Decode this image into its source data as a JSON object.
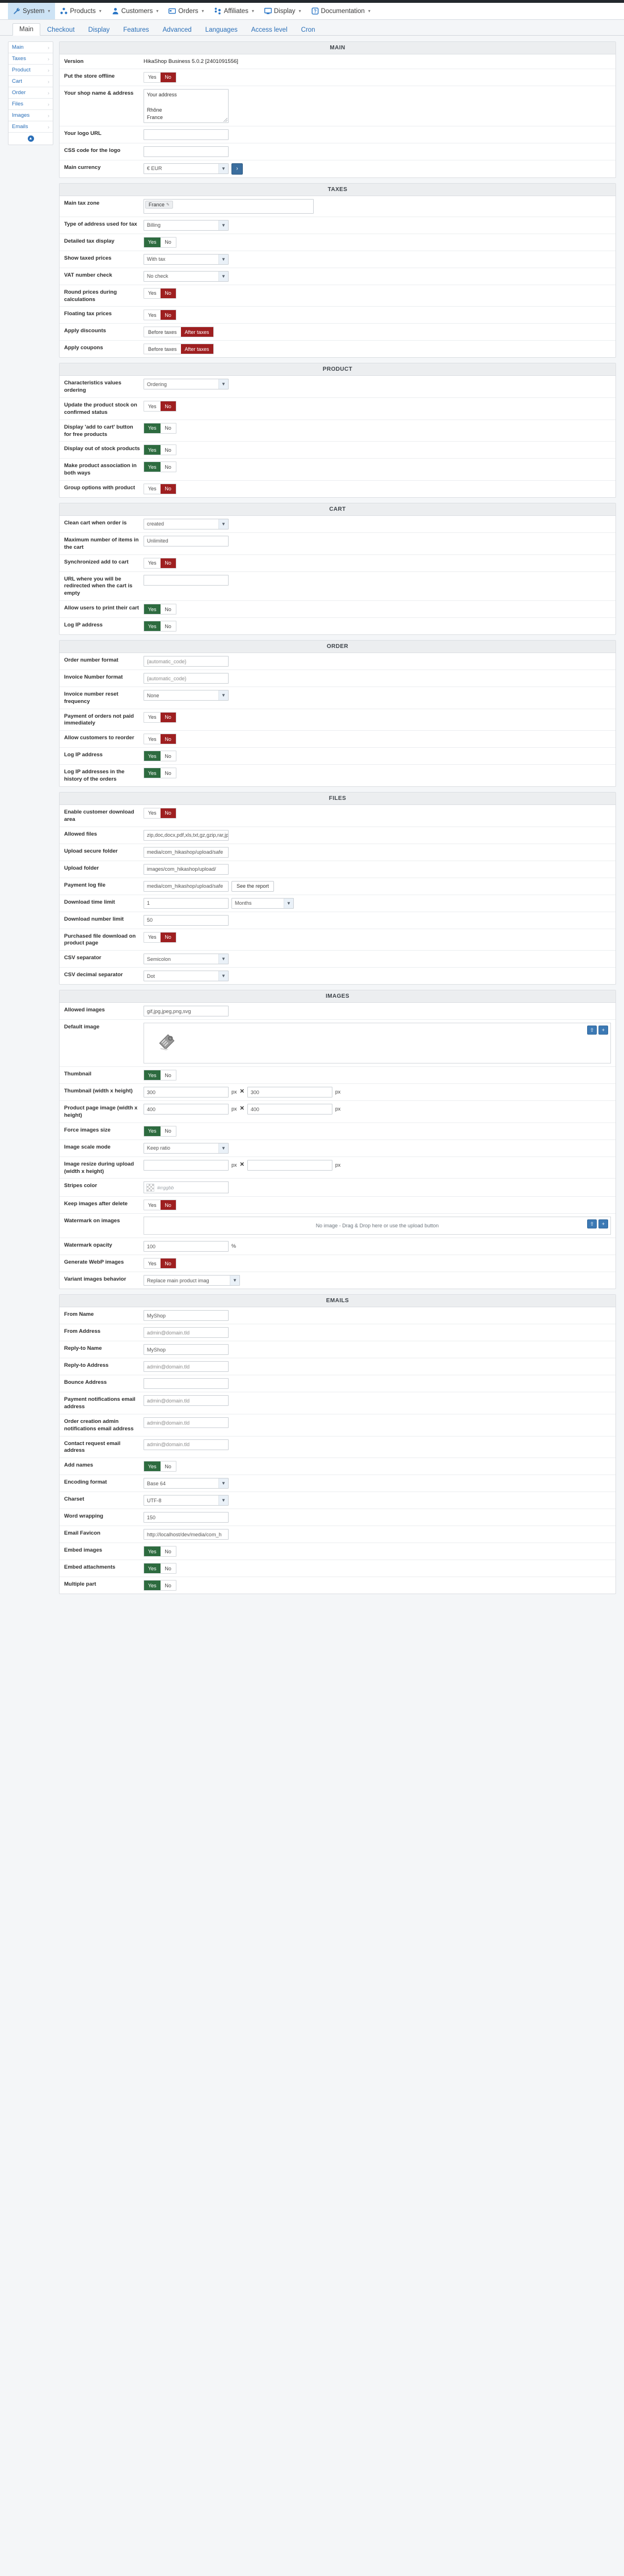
{
  "adminbar": {
    "items": [
      {
        "label": "System",
        "icon": "wrench-icon",
        "active": true
      },
      {
        "label": "Products",
        "icon": "products-icon",
        "active": false
      },
      {
        "label": "Customers",
        "icon": "user-icon",
        "active": false
      },
      {
        "label": "Orders",
        "icon": "orders-icon",
        "active": false
      },
      {
        "label": "Affiliates",
        "icon": "affiliates-icon",
        "active": false
      },
      {
        "label": "Display",
        "icon": "monitor-icon",
        "active": false
      },
      {
        "label": "Documentation",
        "icon": "book-icon",
        "active": false
      }
    ]
  },
  "tabs": [
    {
      "label": "Main",
      "active": true
    },
    {
      "label": "Checkout",
      "active": false
    },
    {
      "label": "Display",
      "active": false
    },
    {
      "label": "Features",
      "active": false
    },
    {
      "label": "Advanced",
      "active": false
    },
    {
      "label": "Languages",
      "active": false
    },
    {
      "label": "Access level",
      "active": false
    },
    {
      "label": "Cron",
      "active": false
    }
  ],
  "sidebar": {
    "items": [
      {
        "label": "Main"
      },
      {
        "label": "Taxes"
      },
      {
        "label": "Product"
      },
      {
        "label": "Cart"
      },
      {
        "label": "Order"
      },
      {
        "label": "Files"
      },
      {
        "label": "Images"
      },
      {
        "label": "Emails"
      }
    ]
  },
  "sections": {
    "main": {
      "title": "MAIN",
      "version_label": "Version",
      "version_value": "HikaShop Business 5.0.2 [2401091556]",
      "offline_label": "Put the store offline",
      "offline_yes": "Yes",
      "offline_no": "No",
      "offline_state": "no",
      "address_label": "Your shop name & address",
      "address_value": "Your address\n\nRhône\nFrance",
      "logo_url_label": "Your logo URL",
      "logo_url_value": "",
      "logo_css_label": "CSS code for the logo",
      "logo_css_value": "",
      "currency_label": "Main currency",
      "currency_value": "€ EUR",
      "currency_go": "›"
    },
    "taxes": {
      "title": "TAXES",
      "zone_label": "Main tax zone",
      "zone_chip": "France",
      "addr_type_label": "Type of address used for tax",
      "addr_type_value": "Billing",
      "detailed_label": "Detailed tax display",
      "detailed_yes": "Yes",
      "detailed_no": "No",
      "detailed_state": "yes",
      "show_taxed_label": "Show taxed prices",
      "show_taxed_value": "With tax",
      "vat_label": "VAT number check",
      "vat_value": "No check",
      "round_label": "Round prices during calculations",
      "round_yes": "Yes",
      "round_no": "No",
      "round_state": "no",
      "float_label": "Floating tax prices",
      "float_yes": "Yes",
      "float_no": "No",
      "float_state": "no",
      "discounts_label": "Apply discounts",
      "discounts_before": "Before taxes",
      "discounts_after": "After taxes",
      "discounts_state": "after",
      "coupons_label": "Apply coupons",
      "coupons_before": "Before taxes",
      "coupons_after": "After taxes",
      "coupons_state": "after"
    },
    "product": {
      "title": "PRODUCT",
      "charord_label": "Characteristics values ordering",
      "charord_value": "Ordering",
      "stock_label": "Update the product stock on confirmed status",
      "stock_yes": "Yes",
      "stock_no": "No",
      "stock_state": "no",
      "freecart_label": "Display 'add to cart' button for free products",
      "freecart_yes": "Yes",
      "freecart_no": "No",
      "freecart_state": "yes",
      "outofstock_label": "Display out of stock products",
      "outofstock_yes": "Yes",
      "outofstock_no": "No",
      "outofstock_state": "yes",
      "assoc_label": "Make product association in both ways",
      "assoc_yes": "Yes",
      "assoc_no": "No",
      "assoc_state": "yes",
      "groupopt_label": "Group options with product",
      "groupopt_yes": "Yes",
      "groupopt_no": "No",
      "groupopt_state": "no"
    },
    "cart": {
      "title": "CART",
      "clean_label": "Clean cart when order is",
      "clean_value": "created",
      "maxitems_label": "Maximum number of items in the cart",
      "maxitems_value": "Unlimited",
      "sync_label": "Synchronized add to cart",
      "sync_yes": "Yes",
      "sync_no": "No",
      "sync_state": "no",
      "redirect_label": "URL where you will be redirected when the cart is empty",
      "redirect_value": "",
      "printcart_label": "Allow users to print their cart",
      "printcart_yes": "Yes",
      "printcart_no": "No",
      "printcart_state": "yes",
      "logip_label": "Log IP address",
      "logip_yes": "Yes",
      "logip_no": "No",
      "logip_state": "yes"
    },
    "order": {
      "title": "ORDER",
      "ordernum_label": "Order number format",
      "ordernum_value": "{automatic_code}",
      "invnum_label": "Invoice Number format",
      "invnum_value": "{automatic_code}",
      "invreset_label": "Invoice number reset frequency",
      "invreset_value": "None",
      "paynotpaid_label": "Payment of orders not paid immediately",
      "paynotpaid_yes": "Yes",
      "paynotpaid_no": "No",
      "paynotpaid_state": "no",
      "reorder_label": "Allow customers to reorder",
      "reorder_yes": "Yes",
      "reorder_no": "No",
      "reorder_state": "no",
      "logip_label": "Log IP address",
      "logip_yes": "Yes",
      "logip_no": "No",
      "logip_state": "yes",
      "loghist_label": "Log IP addresses in the history of the orders",
      "loghist_yes": "Yes",
      "loghist_no": "No",
      "loghist_state": "yes"
    },
    "files": {
      "title": "FILES",
      "dlarea_label": "Enable customer download area",
      "dlarea_yes": "Yes",
      "dlarea_no": "No",
      "dlarea_state": "no",
      "allowed_label": "Allowed files",
      "allowed_value": "zip,doc,docx,pdf,xls,txt,gz,gzip,rar,jpg",
      "securefolder_label": "Upload secure folder",
      "securefolder_value": "media/com_hikashop/upload/safe",
      "uploadfolder_label": "Upload folder",
      "uploadfolder_value": "images/com_hikashop/upload/",
      "paylog_label": "Payment log file",
      "paylog_value": "media/com_hikashop/upload/safe",
      "paylog_button": "See the report",
      "dltime_label": "Download time limit",
      "dltime_value": "1",
      "dltime_unit": "Months",
      "dlnum_label": "Download number limit",
      "dlnum_value": "50",
      "purchased_label": "Purchased file download on product page",
      "purchased_yes": "Yes",
      "purchased_no": "No",
      "purchased_state": "no",
      "csvsep_label": "CSV separator",
      "csvsep_value": "Semicolon",
      "csvdec_label": "CSV decimal separator",
      "csvdec_value": "Dot"
    },
    "images": {
      "title": "IMAGES",
      "allowed_label": "Allowed images",
      "allowed_value": "gif,jpg,jpeg,png,svg",
      "default_label": "Default image",
      "thumb_label": "Thumbnail",
      "thumb_yes": "Yes",
      "thumb_no": "No",
      "thumb_state": "yes",
      "thumbsize_label": "Thumbnail (width x height)",
      "thumbsize_w": "300",
      "thumbsize_h": "300",
      "prodsize_label": "Product page image (width x height)",
      "prodsize_w": "400",
      "prodsize_h": "400",
      "force_label": "Force images size",
      "force_yes": "Yes",
      "force_no": "No",
      "force_state": "yes",
      "scale_label": "Image scale mode",
      "scale_value": "Keep ratio",
      "resize_label": "Image resize during upload (width x height)",
      "resize_w": "",
      "resize_h": "",
      "stripes_label": "Stripes color",
      "stripes_placeholder": "#rrggbb",
      "keep_label": "Keep images after delete",
      "keep_yes": "Yes",
      "keep_no": "No",
      "keep_state": "no",
      "watermark_label": "Watermark on images",
      "watermark_hint": "No image - Drag & Drop here or use the upload button",
      "opacity_label": "Watermark opacity",
      "opacity_value": "100",
      "opacity_unit": "%",
      "webp_label": "Generate WebP images",
      "webp_yes": "Yes",
      "webp_no": "No",
      "webp_state": "no",
      "variant_label": "Variant images behavior",
      "variant_value": "Replace main product imag",
      "unit_px": "px",
      "unit_x": "✕"
    },
    "emails": {
      "title": "EMAILS",
      "fromname_label": "From Name",
      "fromname_value": "MyShop",
      "fromaddr_label": "From Address",
      "fromaddr_value": "admin@domain.tld",
      "replyname_label": "Reply-to Name",
      "replyname_value": "MyShop",
      "replyaddr_label": "Reply-to Address",
      "replyaddr_value": "admin@domain.tld",
      "bounce_label": "Bounce Address",
      "bounce_value": "",
      "paynotif_label": "Payment notifications email address",
      "paynotif_value": "admin@domain.tld",
      "ordernotif_label": "Order creation admin notifications email address",
      "ordernotif_value": "admin@domain.tld",
      "contact_label": "Contact request email address",
      "contact_value": "admin@domain.tld",
      "addnames_label": "Add names",
      "addnames_yes": "Yes",
      "addnames_no": "No",
      "addnames_state": "yes",
      "encoding_label": "Encoding format",
      "encoding_value": "Base 64",
      "charset_label": "Charset",
      "charset_value": "UTF-8",
      "wordwrap_label": "Word wrapping",
      "wordwrap_value": "150",
      "favicon_label": "Email Favicon",
      "favicon_value": "http://localhost/dev/media/com_h",
      "embedimg_label": "Embed images",
      "embedimg_yes": "Yes",
      "embedimg_no": "No",
      "embedimg_state": "yes",
      "embedatt_label": "Embed attachments",
      "embedatt_yes": "Yes",
      "embedatt_no": "No",
      "embedatt_state": "yes",
      "multipart_label": "Multiple part",
      "multipart_yes": "Yes",
      "multipart_no": "No",
      "multipart_state": "yes"
    }
  }
}
